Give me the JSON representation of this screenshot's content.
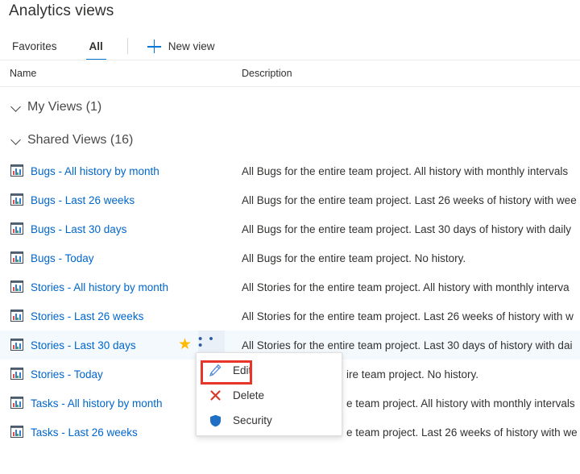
{
  "page": {
    "title": "Analytics views"
  },
  "colors": {
    "accent": "#0078d4",
    "link": "#0066cc",
    "star": "#ffb900",
    "annotation": "#e8352a",
    "delete_icon": "#d93b2b",
    "security_icon": "#1f6fc4",
    "selected_row_bg": "#f3f9fd"
  },
  "tabs": [
    {
      "label": "Favorites",
      "active": false
    },
    {
      "label": "All",
      "active": true
    }
  ],
  "commands": {
    "new_view_label": "New view",
    "new_view_icon": "plus-icon"
  },
  "columns": {
    "name": "Name",
    "description": "Description"
  },
  "groups": [
    {
      "label": "My Views (1)",
      "expanded": true
    },
    {
      "label": "Shared Views (16)",
      "expanded": true
    }
  ],
  "rows": [
    {
      "icon": "report-icon",
      "name": "Bugs - All history by month",
      "description": "All Bugs for the entire team project. All history with monthly intervals",
      "selected": false
    },
    {
      "icon": "report-icon",
      "name": "Bugs - Last 26 weeks",
      "description": "All Bugs for the entire team project. Last 26 weeks of history with wee",
      "selected": false
    },
    {
      "icon": "report-icon",
      "name": "Bugs - Last 30 days",
      "description": "All Bugs for the entire team project. Last 30 days of history with daily",
      "selected": false
    },
    {
      "icon": "report-icon",
      "name": "Bugs - Today",
      "description": "All Bugs for the entire team project. No history.",
      "selected": false
    },
    {
      "icon": "report-icon",
      "name": "Stories - All history by month",
      "description": "All Stories for the entire team project. All history with monthly interva",
      "selected": false
    },
    {
      "icon": "report-icon",
      "name": "Stories - Last 26 weeks",
      "description": "All Stories for the entire team project. Last 26 weeks of history with w",
      "selected": false
    },
    {
      "icon": "report-icon",
      "name": "Stories - Last 30 days",
      "description": "All Stories for the entire team project. Last 30 days of history with dai",
      "selected": true,
      "favorite": true,
      "more_actions": "• • •"
    },
    {
      "icon": "report-icon",
      "name": "Stories - Today",
      "description": "ire team project. No history.",
      "selected": false
    },
    {
      "icon": "report-icon",
      "name": "Tasks - All history by month",
      "description": "e team project. All history with monthly intervals",
      "selected": false
    },
    {
      "icon": "report-icon",
      "name": "Tasks - Last 26 weeks",
      "description": "e team project. Last 26 weeks of history with we",
      "selected": false
    }
  ],
  "context_menu": {
    "items": [
      {
        "label": "Edit",
        "icon": "pencil-icon",
        "highlighted": true
      },
      {
        "label": "Delete",
        "icon": "x-icon",
        "highlighted": false
      },
      {
        "label": "Security",
        "icon": "shield-icon",
        "highlighted": false
      }
    ]
  }
}
